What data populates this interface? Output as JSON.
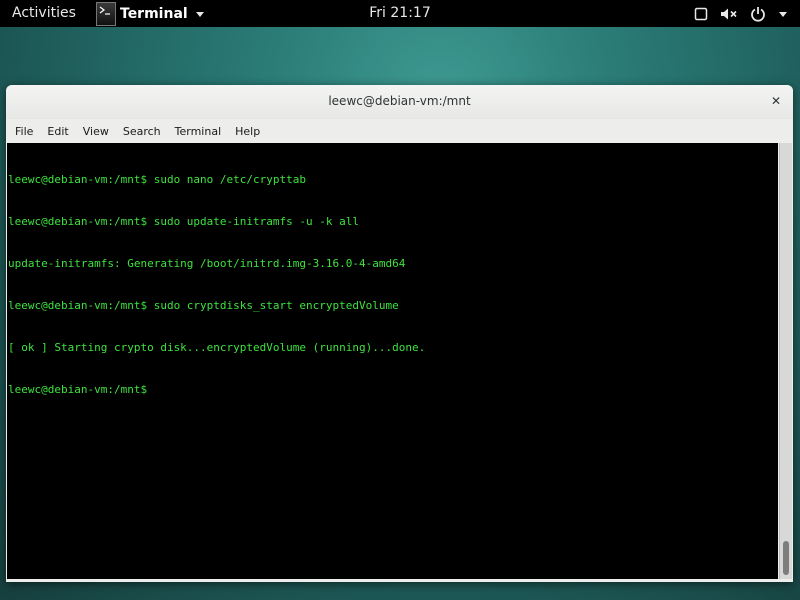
{
  "topbar": {
    "activities_label": "Activities",
    "app_name": "Terminal",
    "clock": "Fri 21:17",
    "icons": [
      "screen-icon",
      "volume-muted-icon",
      "power-icon",
      "chevron-down-icon"
    ]
  },
  "window": {
    "title": "leewc@debian-vm:/mnt",
    "close_glyph": "✕",
    "menu": [
      "File",
      "Edit",
      "View",
      "Search",
      "Terminal",
      "Help"
    ]
  },
  "terminal": {
    "text_color": "#3ee23e",
    "lines": [
      "leewc@debian-vm:/mnt$ sudo nano /etc/crypttab",
      "leewc@debian-vm:/mnt$ sudo update-initramfs -u -k all",
      "update-initramfs: Generating /boot/initrd.img-3.16.0-4-amd64",
      "leewc@debian-vm:/mnt$ sudo cryptdisks_start encryptedVolume",
      "[ ok ] Starting crypto disk...encryptedVolume (running)...done.",
      "leewc@debian-vm:/mnt$"
    ]
  }
}
